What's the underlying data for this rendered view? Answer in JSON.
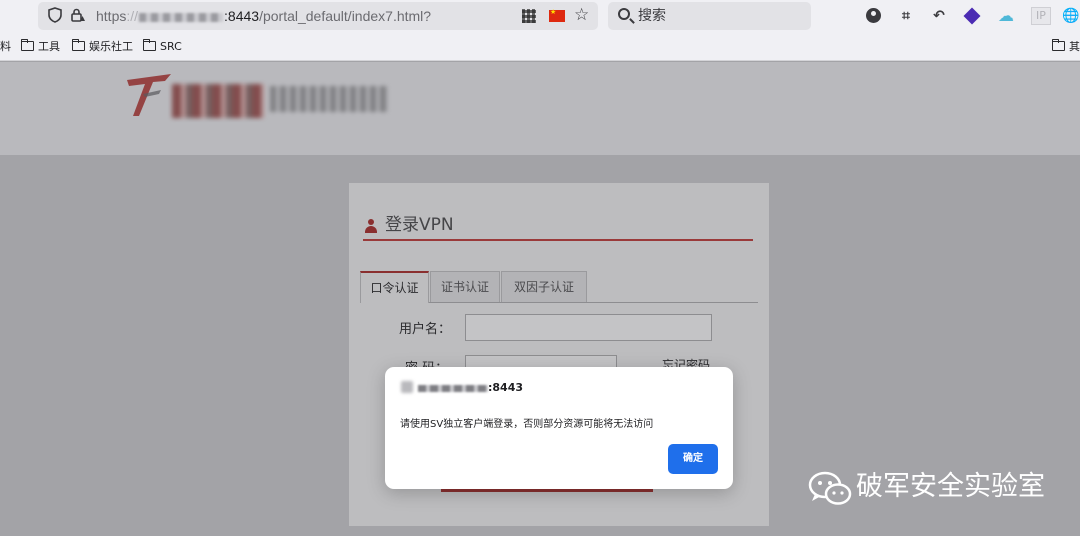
{
  "browser": {
    "url_scheme": "https",
    "url_host_suffix": ":8443",
    "url_path": "/portal_default/index7.html?",
    "search_placeholder": "搜索",
    "ip_badge": "IP"
  },
  "bookmarks": {
    "cut_left": "料",
    "items": [
      "工具",
      "娱乐社工",
      "SRC"
    ],
    "cut_right": "其"
  },
  "login": {
    "title": "登录VPN",
    "tabs": [
      "口令认证",
      "证书认证",
      "双因子认证"
    ],
    "username_label": "用户名：",
    "password_label": "密  码：",
    "remember_label": "忘记密码"
  },
  "dialog": {
    "host_suffix": ":8443",
    "message": "请使用SV独立客户端登录，否则部分资源可能将无法访问",
    "ok_label": "确定"
  },
  "watermark": {
    "text": "破军安全实验室"
  }
}
